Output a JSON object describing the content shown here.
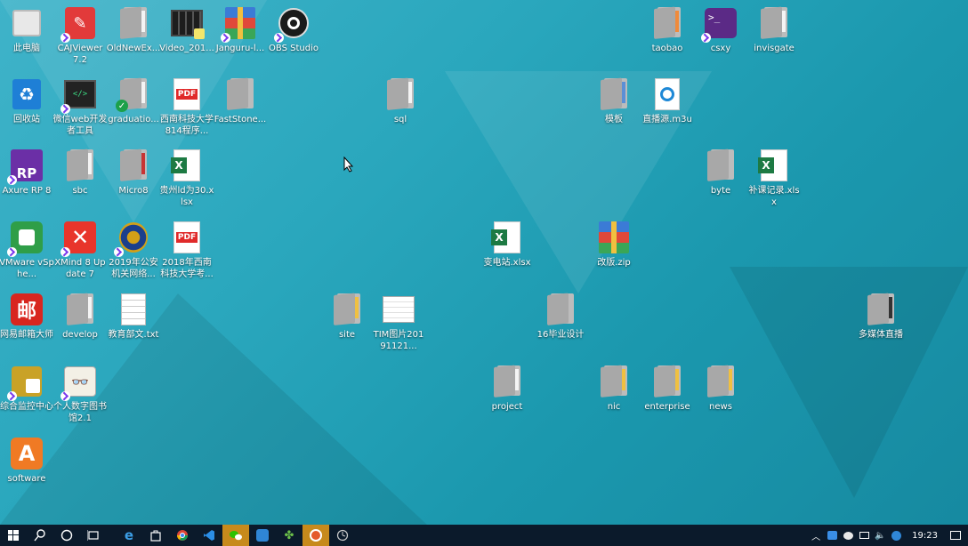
{
  "desktop": {
    "icons": [
      {
        "label": "此电脑"
      },
      {
        "label": "CAJViewer 7.2"
      },
      {
        "label": "OldNewEx..."
      },
      {
        "label": "Video_201..."
      },
      {
        "label": "Janguru-l..."
      },
      {
        "label": "OBS Studio"
      },
      {
        "label": "回收站"
      },
      {
        "label": "微信web开发者工具"
      },
      {
        "label": "graduatio..."
      },
      {
        "label": "西南科技大学 814程序..."
      },
      {
        "label": "FastStone..."
      },
      {
        "label": "Axure RP 8"
      },
      {
        "label": "sbc"
      },
      {
        "label": "Micro8"
      },
      {
        "label": "贵州ld为30.xlsx"
      },
      {
        "label": "VMware vSphe..."
      },
      {
        "label": "XMind 8 Update 7"
      },
      {
        "label": "2019年公安机关网络..."
      },
      {
        "label": "2018年西南科技大学考..."
      },
      {
        "label": "网易邮箱大师"
      },
      {
        "label": "develop"
      },
      {
        "label": "教育部文.txt"
      },
      {
        "label": "综合监控中心"
      },
      {
        "label": "个人数字图书馆2.1"
      },
      {
        "label": "software"
      },
      {
        "label": "sql"
      },
      {
        "label": "变电站.xlsx"
      },
      {
        "label": "site"
      },
      {
        "label": "TIM图片20191121..."
      },
      {
        "label": "16毕业设计"
      },
      {
        "label": "project"
      },
      {
        "label": "taobao"
      },
      {
        "label": "csxy"
      },
      {
        "label": "invisgate"
      },
      {
        "label": "模板"
      },
      {
        "label": "直播源.m3u"
      },
      {
        "label": "byte"
      },
      {
        "label": "补课记录.xlsx"
      },
      {
        "label": "改版.zip"
      },
      {
        "label": "多媒体直播"
      },
      {
        "label": "nic"
      },
      {
        "label": "enterprise"
      },
      {
        "label": "news"
      }
    ]
  },
  "taskbar": {
    "clock": "19:23"
  },
  "colors": {
    "accent_active": "#c78a1c",
    "taskbar_bg": "#0b1a2b"
  }
}
